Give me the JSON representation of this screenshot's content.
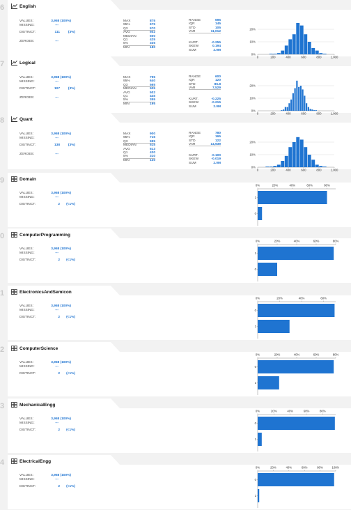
{
  "colors": {
    "accent": "#1f74d1",
    "background": "#f2f2f2",
    "card": "#ffffff",
    "index": "#c9c9c9"
  },
  "labels": {
    "values": "VALUES:",
    "missing": "MISSING:",
    "distinct": "DISTINCT:",
    "zeroes": "ZEROES:"
  },
  "numeric": [
    {
      "index": "6",
      "name": "English",
      "icon": "histogram-icon",
      "values": "3,958 (100%)",
      "missing": "---",
      "distinct": "111",
      "distinct_pct": "(3%)",
      "zeroes": "---",
      "quantiles": [
        [
          "MAX",
          "875"
        ],
        [
          "95%",
          "675"
        ],
        [
          "Q3",
          "570"
        ],
        [
          "AVG",
          "502"
        ],
        [
          "MEDIAN",
          "500"
        ],
        [
          "Q1",
          "425"
        ],
        [
          "5%",
          "335"
        ],
        [
          "MIN",
          "180"
        ]
      ],
      "stats1": [
        [
          "RANGE",
          "695"
        ],
        [
          "IQR",
          "145"
        ],
        [
          "STD",
          "105"
        ],
        [
          "VAR",
          "11,012"
        ]
      ],
      "stats2": [
        [
          "KURT.",
          "-0.255"
        ],
        [
          "SKEW",
          "0.194"
        ],
        [
          "SUM",
          "2.0M"
        ]
      ],
      "chart_data": {
        "type": "bar",
        "x_ticks": [
          "0",
          "200",
          "400",
          "600",
          "800",
          "1,000"
        ],
        "y_ticks": [
          "0%",
          "10%",
          "20%"
        ],
        "xlim": [
          0,
          1000
        ],
        "ylim": [
          0,
          25
        ],
        "bin_width": 50,
        "bin_starts": [
          150,
          200,
          250,
          300,
          350,
          400,
          450,
          500,
          550,
          600,
          650,
          700,
          750,
          800,
          850
        ],
        "values": [
          0.5,
          0.5,
          1,
          3,
          7,
          12,
          16,
          25,
          23,
          16,
          10,
          5,
          3,
          1,
          0.5
        ]
      }
    },
    {
      "index": "7",
      "name": "Logical",
      "icon": "histogram-icon",
      "values": "3,958 (100%)",
      "missing": "---",
      "distinct": "107",
      "distinct_pct": "(3%)",
      "zeroes": "---",
      "quantiles": [
        [
          "MAX",
          "795"
        ],
        [
          "95%",
          "640"
        ],
        [
          "Q3",
          "565"
        ],
        [
          "MEDIAN",
          "505"
        ],
        [
          "AVG",
          "502"
        ],
        [
          "Q1",
          "445"
        ],
        [
          "5%",
          "355"
        ],
        [
          "MIN",
          "195"
        ]
      ],
      "stats1": [
        [
          "RANGE",
          "600"
        ],
        [
          "IQR",
          "120"
        ],
        [
          "STD",
          "86.8"
        ],
        [
          "VAR",
          "7,529"
        ]
      ],
      "stats2": [
        [
          "KURT.",
          "-0.225"
        ],
        [
          "SKEW",
          "-0.215"
        ],
        [
          "SUM",
          "2.0M"
        ]
      ],
      "chart_data": {
        "type": "bar",
        "x_ticks": [
          "0",
          "200",
          "400",
          "600",
          "800",
          "1,000"
        ],
        "y_ticks": [
          "0%",
          "10%",
          "20%"
        ],
        "xlim": [
          0,
          1000
        ],
        "ylim": [
          0,
          25
        ],
        "bin_width": 25,
        "bin_starts": [
          300,
          325,
          350,
          375,
          400,
          425,
          450,
          475,
          500,
          525,
          550,
          575,
          600,
          625,
          650,
          675,
          700,
          725,
          750
        ],
        "values": [
          0.5,
          1,
          3,
          3,
          6,
          9,
          14,
          18,
          24,
          19,
          20,
          17,
          12,
          6,
          3,
          1.5,
          1,
          0.5,
          0.5
        ]
      }
    },
    {
      "index": "8",
      "name": "Quant",
      "icon": "histogram-icon",
      "values": "3,958 (100%)",
      "missing": "---",
      "distinct": "138",
      "distinct_pct": "(3%)",
      "zeroes": "---",
      "quantiles": [
        [
          "MAX",
          "900"
        ],
        [
          "95%",
          "715"
        ],
        [
          "Q3",
          "595"
        ],
        [
          "MEDIAN",
          "515"
        ],
        [
          "AVG",
          "513"
        ],
        [
          "Q1",
          "430"
        ],
        [
          "5%",
          "310"
        ],
        [
          "MIN",
          "120"
        ]
      ],
      "stats1": [
        [
          "RANGE",
          "780"
        ],
        [
          "IQR",
          "165"
        ],
        [
          "STD",
          "122"
        ],
        [
          "VAR",
          "14,939"
        ]
      ],
      "stats2": [
        [
          "KURT.",
          "-0.100"
        ],
        [
          "SKEW",
          "-0.019"
        ],
        [
          "SUM",
          "2.0M"
        ]
      ],
      "chart_data": {
        "type": "bar",
        "x_ticks": [
          "0",
          "200",
          "400",
          "600",
          "800",
          "1,000"
        ],
        "y_ticks": [
          "0%",
          "10%",
          "20%"
        ],
        "xlim": [
          0,
          1000
        ],
        "ylim": [
          0,
          25
        ],
        "bin_width": 50,
        "bin_starts": [
          100,
          150,
          200,
          250,
          300,
          350,
          400,
          450,
          500,
          550,
          600,
          650,
          700,
          750,
          800,
          850
        ],
        "values": [
          0.5,
          0.5,
          1,
          2,
          5,
          9,
          16,
          20,
          24,
          22,
          16,
          10,
          6,
          2,
          1,
          0.5
        ]
      }
    }
  ],
  "categorical": [
    {
      "index": "9",
      "name": "Domain",
      "icon": "grid-icon",
      "values": "3,958 (100%)",
      "missing": "---",
      "distinct": "2",
      "distinct_pct": "(<1%)",
      "chart_data": {
        "type": "bar",
        "orientation": "horizontal",
        "x_ticks": [
          "0%",
          "20%",
          "40%",
          "60%",
          "80%"
        ],
        "xlim": [
          0,
          90
        ],
        "categories": [
          "1",
          "0"
        ],
        "values": [
          80,
          5
        ]
      }
    },
    {
      "index": "0",
      "name": "ComputerProgramming",
      "icon": "grid-icon",
      "values": "3,958 (100%)",
      "missing": "---",
      "distinct": "2",
      "distinct_pct": "(<1%)",
      "chart_data": {
        "type": "bar",
        "orientation": "horizontal",
        "x_ticks": [
          "0%",
          "20%",
          "40%",
          "60%",
          "80%"
        ],
        "xlim": [
          0,
          80
        ],
        "categories": [
          "1",
          "0"
        ],
        "values": [
          78,
          20
        ]
      }
    },
    {
      "index": "1",
      "name": "ElectronicsAndSemicon",
      "icon": "grid-icon",
      "values": "3,958 (100%)",
      "missing": "---",
      "distinct": "2",
      "distinct_pct": "(<1%)",
      "chart_data": {
        "type": "bar",
        "orientation": "horizontal",
        "x_ticks": [
          "0%",
          "20%",
          "40%",
          "60%"
        ],
        "xlim": [
          0,
          71
        ],
        "categories": [
          "0",
          "1"
        ],
        "values": [
          70,
          29
        ]
      }
    },
    {
      "index": "2",
      "name": "ComputerScience",
      "icon": "grid-icon",
      "values": "3,958 (100%)",
      "missing": "---",
      "distinct": "2",
      "distinct_pct": "(<1%)",
      "chart_data": {
        "type": "bar",
        "orientation": "horizontal",
        "x_ticks": [
          "0%",
          "20%",
          "40%",
          "60%",
          "80%"
        ],
        "xlim": [
          0,
          80
        ],
        "categories": [
          "0",
          "1"
        ],
        "values": [
          78,
          22
        ]
      }
    },
    {
      "index": "3",
      "name": "MechanicalEngg",
      "icon": "grid-icon",
      "values": "3,958 (100%)",
      "missing": "---",
      "distinct": "2",
      "distinct_pct": "(<1%)",
      "chart_data": {
        "type": "bar",
        "orientation": "horizontal",
        "x_ticks": [
          "0%",
          "20%",
          "40%",
          "60%",
          "80%"
        ],
        "xlim": [
          0,
          96
        ],
        "categories": [
          "0",
          "1"
        ],
        "values": [
          95,
          5
        ]
      }
    },
    {
      "index": "4",
      "name": "ElectricalEngg",
      "icon": "grid-icon",
      "values": "3,958 (100%)",
      "missing": "---",
      "distinct": "2",
      "distinct_pct": "(<1%)",
      "chart_data": {
        "type": "bar",
        "orientation": "horizontal",
        "x_ticks": [
          "0%",
          "20%",
          "40%",
          "60%",
          "80%",
          "100%"
        ],
        "xlim": [
          0,
          100
        ],
        "categories": [
          "0",
          "1"
        ],
        "values": [
          98,
          2
        ]
      }
    }
  ]
}
